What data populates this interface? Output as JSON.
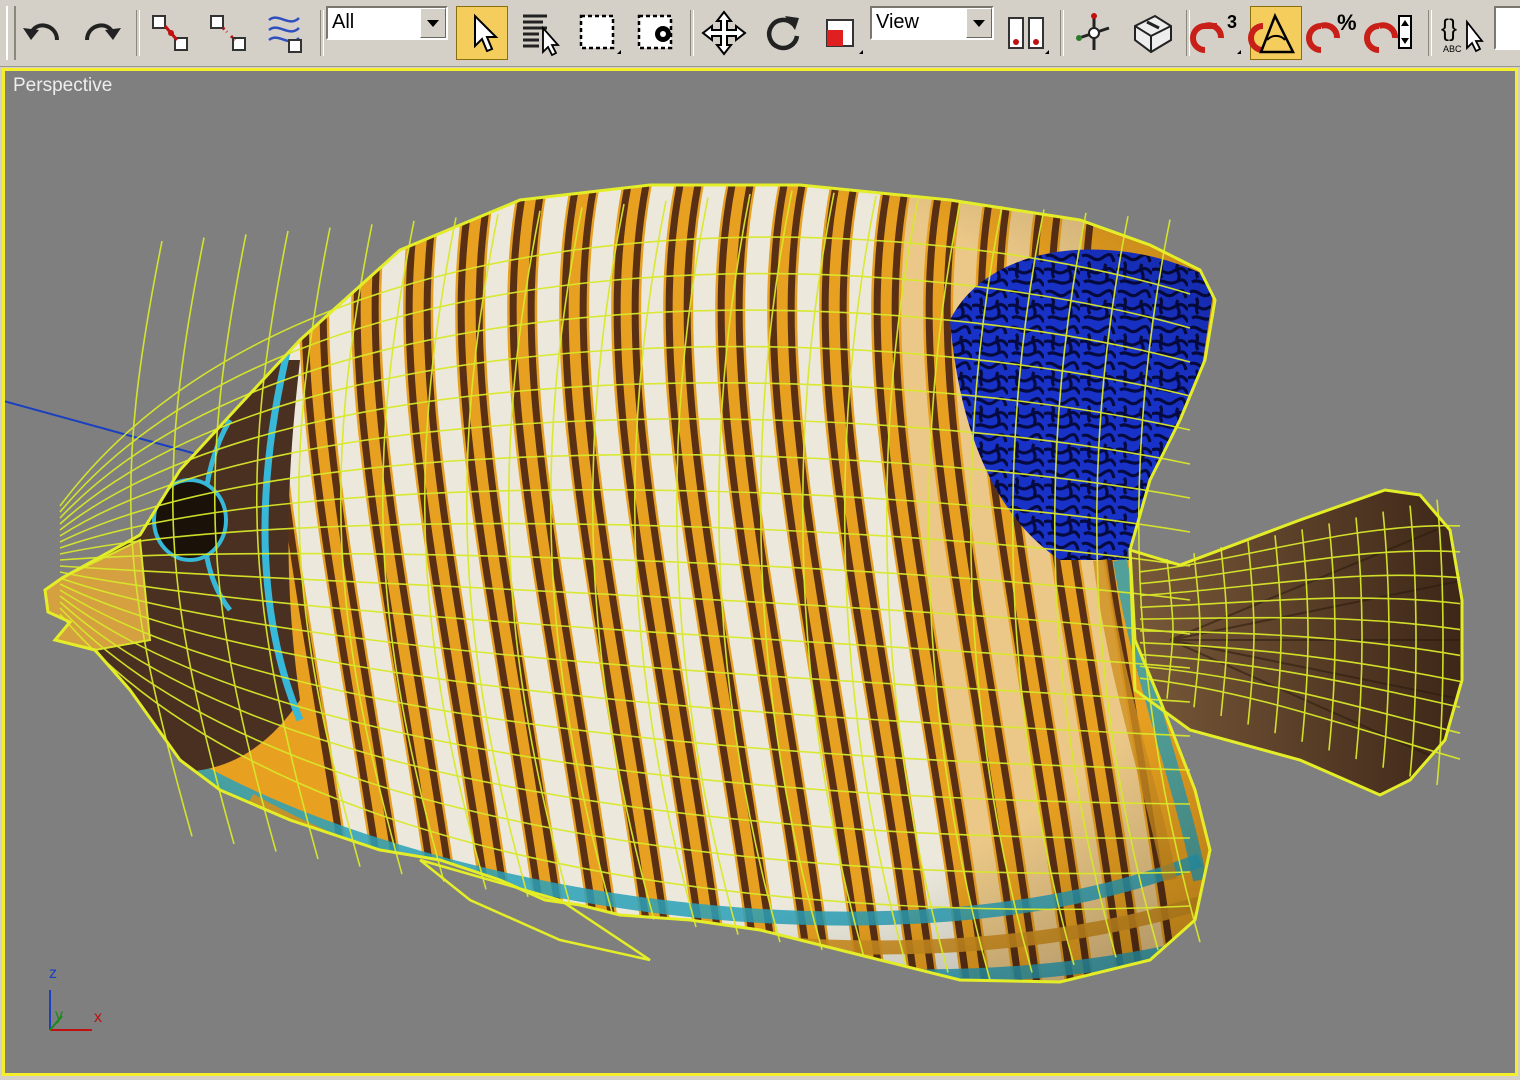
{
  "toolbar": {
    "selection_filter": {
      "selected": "All"
    },
    "ref_coord_system": {
      "selected": "View"
    },
    "snaps_badge": "3",
    "percent_snap_badge": "%",
    "named_selection_badge": "ABC"
  },
  "viewport": {
    "label": "Perspective",
    "border_color": "#f5ee2c",
    "background": "#7f7f7f",
    "axis_tripod": {
      "z": "z",
      "y": "y",
      "x": "x"
    }
  },
  "colors": {
    "ui_gray": "#d4d0c8",
    "active_button": "#f4cd5c",
    "wireframe": "#d8e82a",
    "stripe_orange": "#e8a020",
    "stripe_white": "#ece9dc",
    "stripe_brown": "#5a3015",
    "pattern_blue": "#1530c8"
  }
}
